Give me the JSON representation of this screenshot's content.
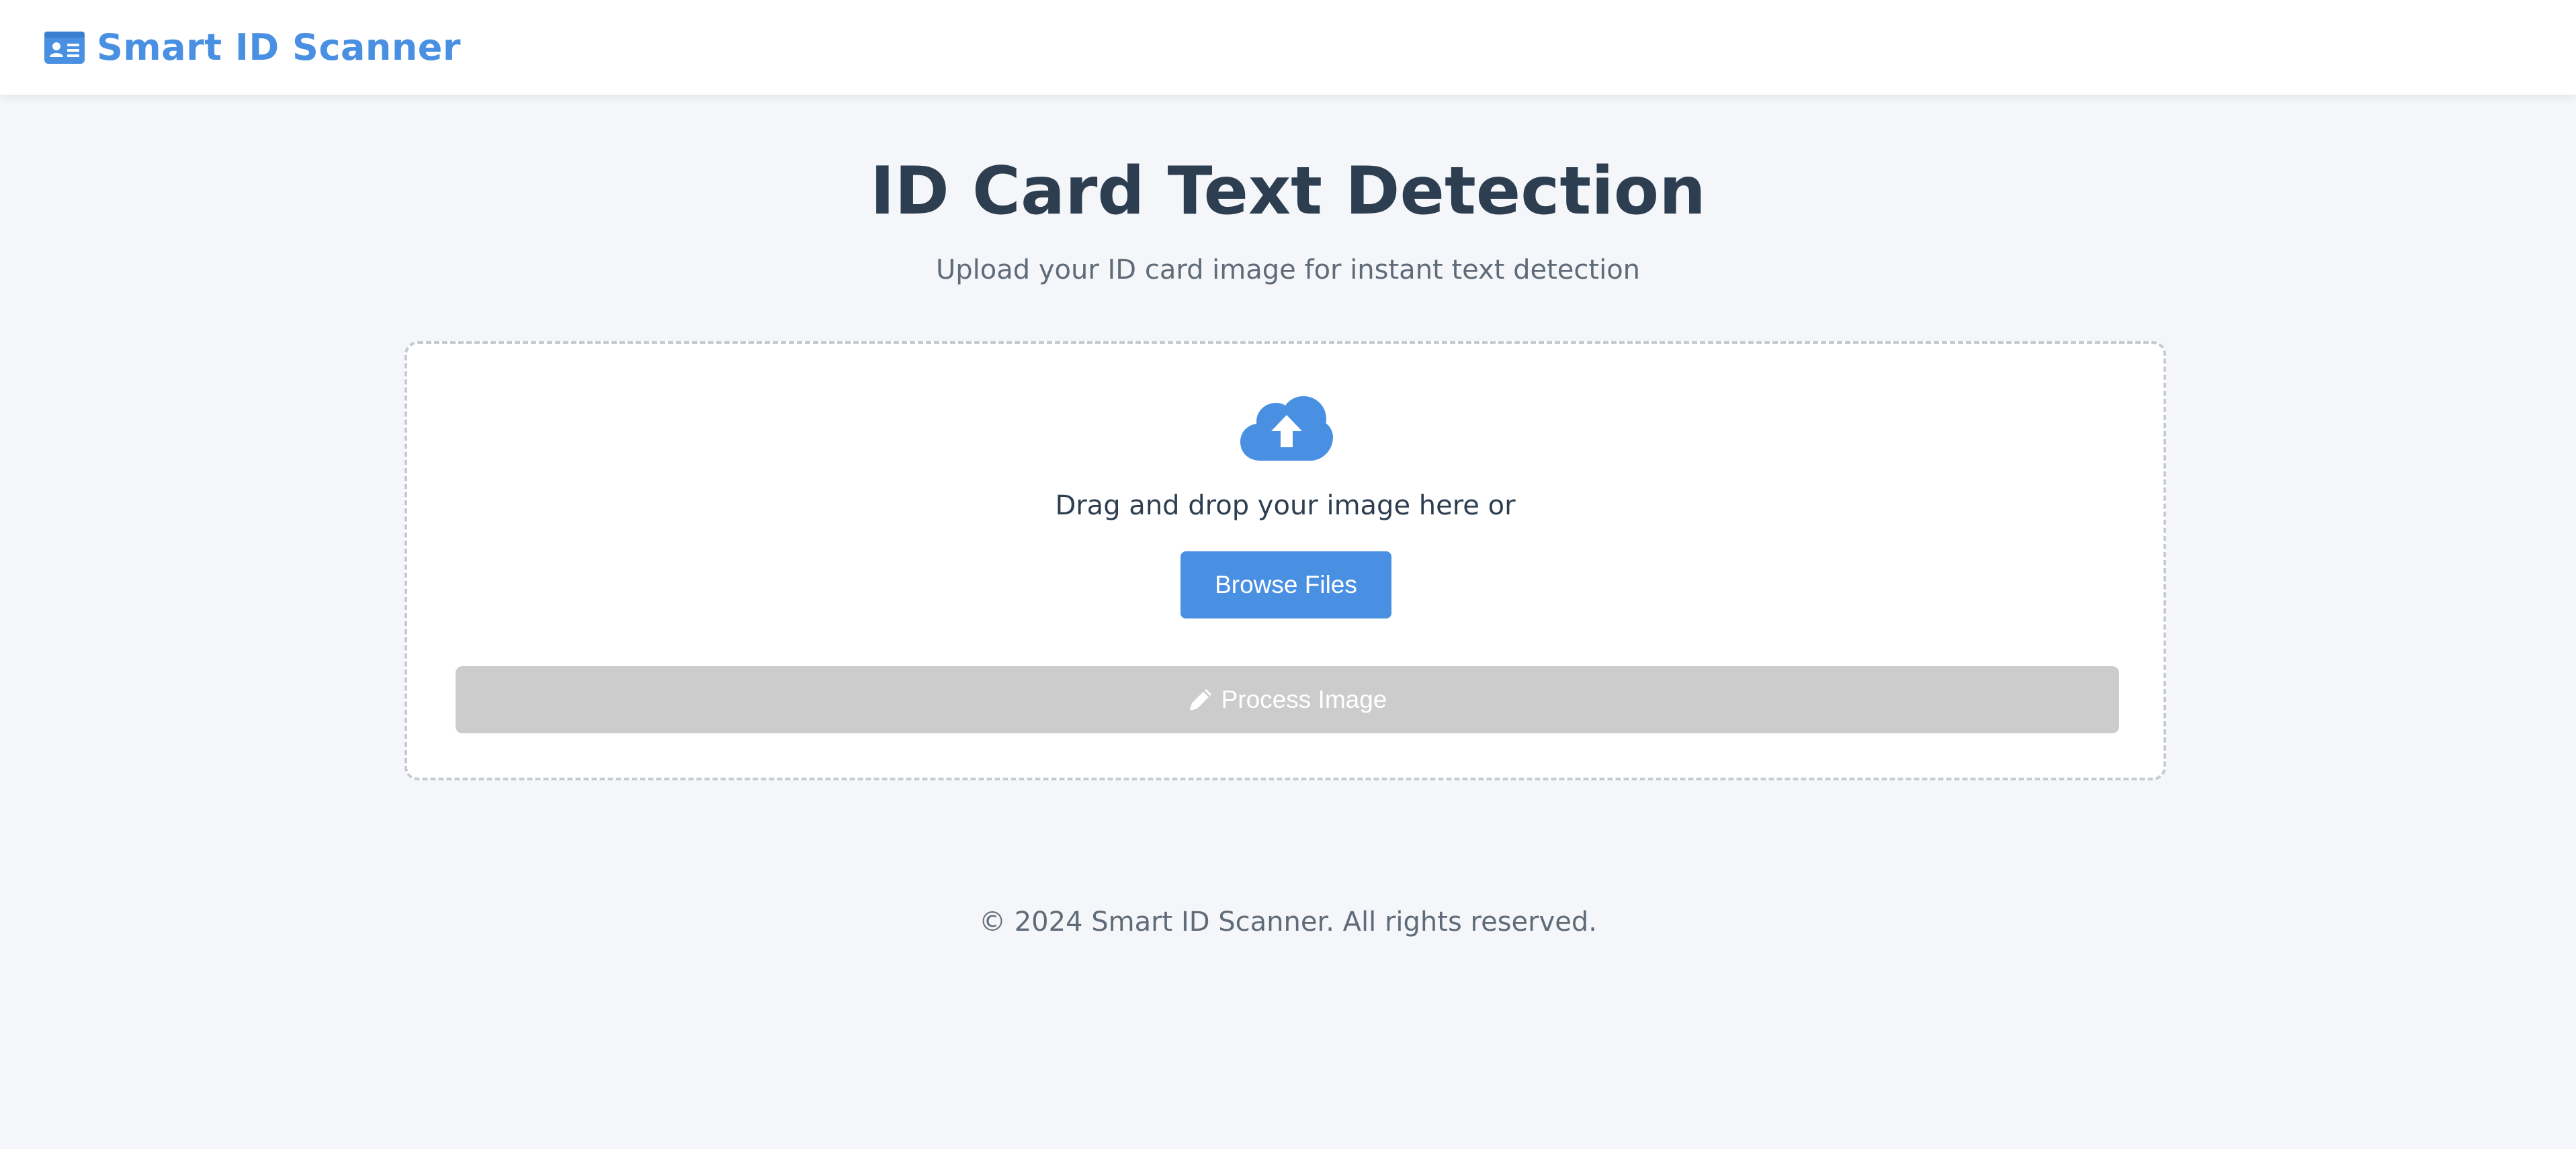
{
  "navbar": {
    "brand_icon": "id-card-icon",
    "brand_title": "Smart ID Scanner"
  },
  "main": {
    "title": "ID Card Text Detection",
    "subtitle": "Upload your ID card image for instant text detection"
  },
  "upload": {
    "icon": "cloud-upload-icon",
    "drop_text": "Drag and drop your image here or",
    "browse_label": "Browse Files",
    "process_icon": "pencil-icon",
    "process_label": "Process Image",
    "process_disabled": true
  },
  "footer": {
    "text": "© 2024 Smart ID Scanner. All rights reserved."
  },
  "colors": {
    "accent": "#4a90e2",
    "heading": "#2c3e50",
    "muted_text": "#5f6b78",
    "disabled_button": "#cccccc",
    "page_background": "#f4f6f9"
  }
}
